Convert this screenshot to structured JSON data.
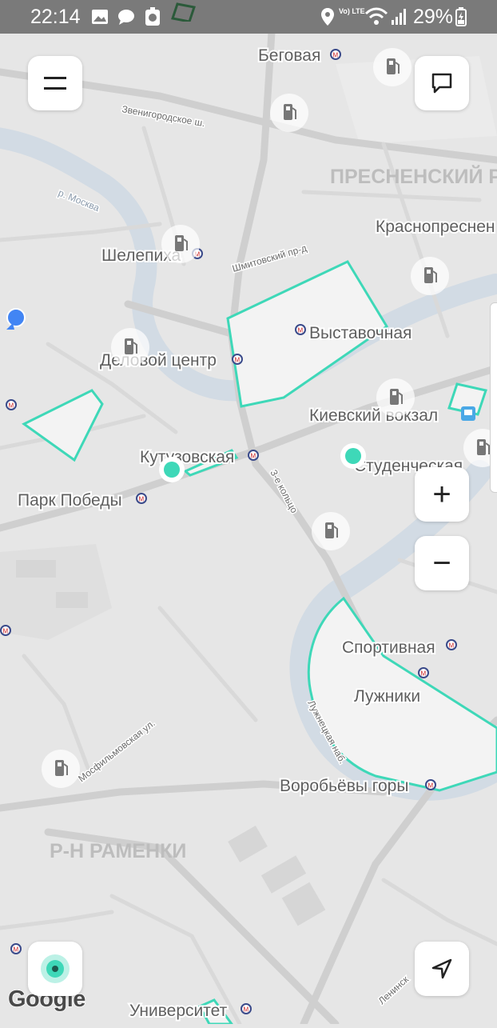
{
  "status_bar": {
    "time": "22:14",
    "battery": "29%",
    "network": "Vo) LTE",
    "icons": [
      "gallery-icon",
      "message-icon",
      "alarm-icon",
      "location-icon",
      "wifi-icon",
      "signal-icon",
      "battery-icon"
    ]
  },
  "buttons": {
    "menu": "menu-icon",
    "chat": "chat-icon",
    "zoom_in": "+",
    "zoom_out": "−",
    "my_location": "navigation-arrow-icon",
    "locate": "location-target-icon"
  },
  "map": {
    "provider": "Google",
    "district_labels": [
      "ПРЕСНЕНСКИЙ Р",
      "Р-Н РАМЕНКИ"
    ],
    "metro_stations": [
      "Беговая",
      "Краснопреснен",
      "Шелепиха",
      "Выставочная",
      "Деловой центр",
      "Киевский вокзал",
      "Кутузовская",
      "Студенческая",
      "Парк Победы",
      "Спортивная",
      "Воробьёвы горы",
      "Университет"
    ],
    "place_labels": [
      "Лужники"
    ],
    "street_labels": [
      "Звенигородское ш.",
      "р. Москва",
      "Шмитовский пр-д",
      "3-е кольцо",
      "Лужнецкая наб.",
      "Мосфильмовская ул.",
      "Ленинск"
    ],
    "accent_color": "#3ed8b8",
    "user_dot_color": "#4285f4"
  }
}
